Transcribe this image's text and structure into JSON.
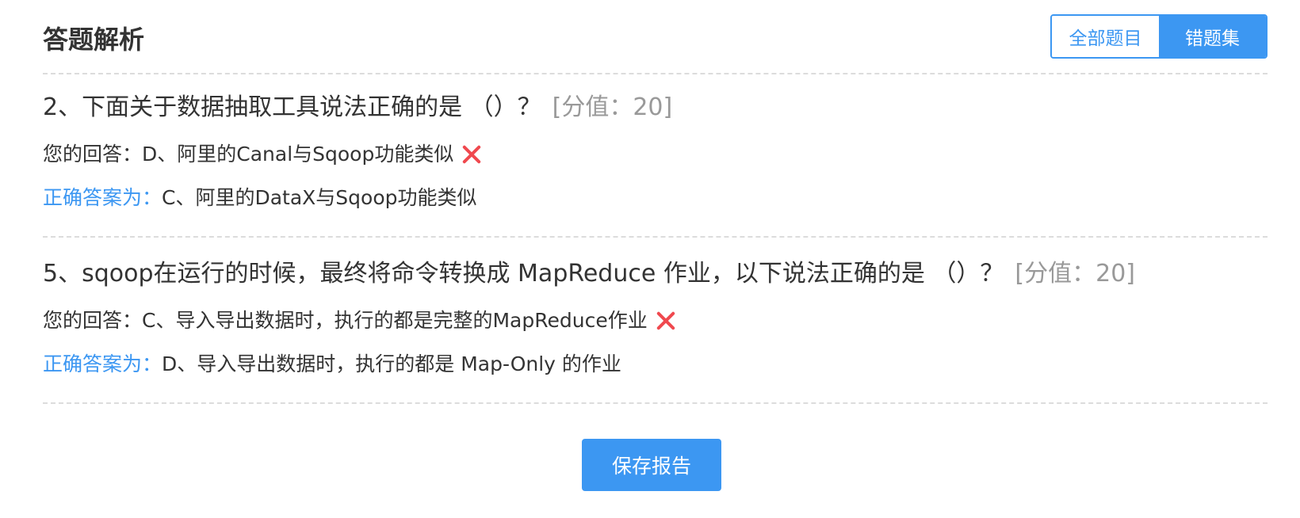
{
  "header": {
    "title": "答题解析",
    "toggle": {
      "all_label": "全部题目",
      "wrong_label": "错题集",
      "active": "错题集"
    }
  },
  "questions": [
    {
      "title": "2、下面关于数据抽取工具说法正确的是 （）？",
      "score": "[分值：20]",
      "your_answer_label": "您的回答：",
      "your_answer": "D、阿里的Canal与Sqoop功能类似",
      "correct_label": "正确答案为：",
      "correct_answer": "C、阿里的DataX与Sqoop功能类似",
      "result_icon": "wrong-icon"
    },
    {
      "title": "5、sqoop在运行的时候，最终将命令转换成 MapReduce 作业，以下说法正确的是 （）？",
      "score": "[分值：20]",
      "your_answer_label": "您的回答：",
      "your_answer": "C、导入导出数据时，执行的都是完整的MapReduce作业",
      "correct_label": "正确答案为：",
      "correct_answer": "D、导入导出数据时，执行的都是 Map-Only 的作业",
      "result_icon": "wrong-icon"
    }
  ],
  "footer": {
    "save_label": "保存报告"
  },
  "colors": {
    "accent": "#3c97f2",
    "wrong": "#f0494f",
    "score": "#999999",
    "divider": "#dcdcdc"
  }
}
